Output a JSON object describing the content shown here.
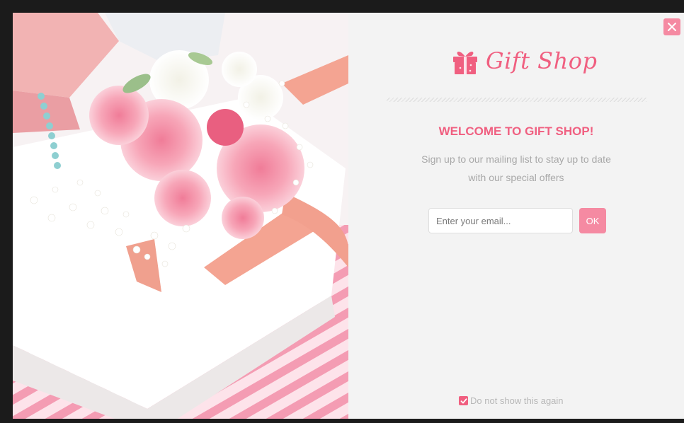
{
  "popup": {
    "brand": "Gift Shop",
    "heading": "WELCOME TO GIFT SHOP!",
    "description_line1": "Sign up to our mailing list to stay up to date",
    "description_line2": "with our special offers",
    "email_placeholder": "Enter your email...",
    "email_value": "",
    "ok_label": "OK",
    "dont_show_label": "Do not show this again",
    "dont_show_checked": true
  },
  "icons": {
    "close": "close-icon",
    "logo": "gift-icon",
    "checkbox": "check-icon"
  },
  "colors": {
    "accent": "#f05f80",
    "accent_light": "#f58aa2",
    "panel_bg": "#f3f3f3",
    "muted_text": "#a8a8a8"
  }
}
